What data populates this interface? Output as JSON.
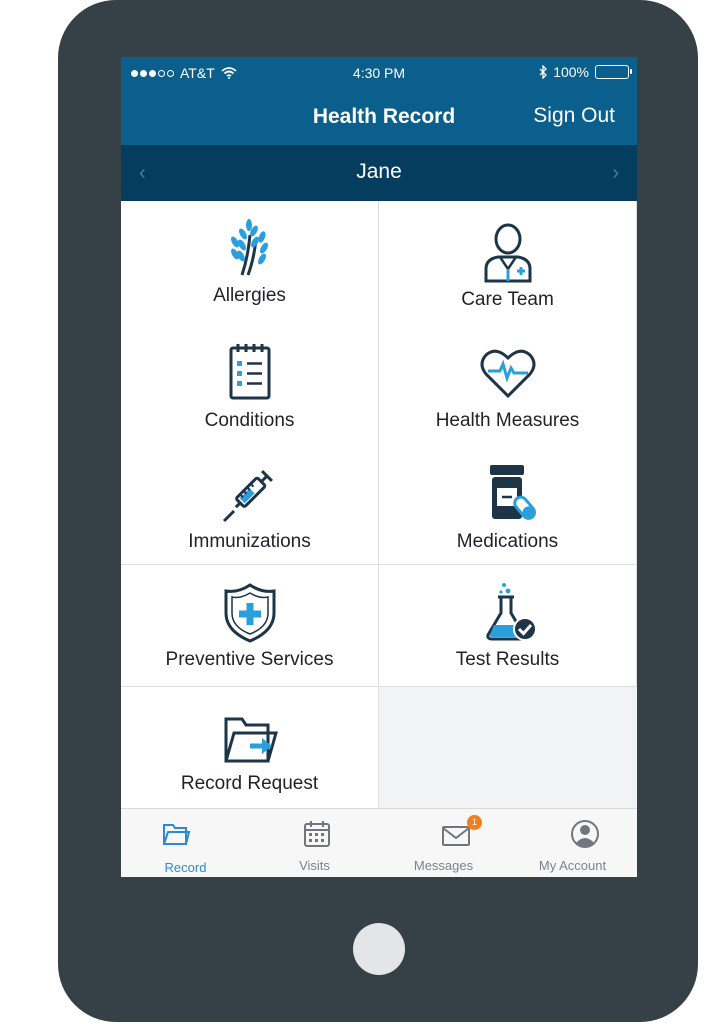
{
  "status_bar": {
    "carrier": "AT&T",
    "time": "4:30 PM",
    "battery": "100%"
  },
  "nav": {
    "title": "Health Record",
    "sign_out": "Sign Out"
  },
  "patient": {
    "name": "Jane",
    "prev": "‹",
    "next": "›"
  },
  "tiles": [
    {
      "label": "Allergies",
      "icon": "wheat-icon"
    },
    {
      "label": "Care Team",
      "icon": "doctor-icon"
    },
    {
      "label": "Conditions",
      "icon": "clipboard-list-icon"
    },
    {
      "label": "Health Measures",
      "icon": "heart-pulse-icon"
    },
    {
      "label": "Immunizations",
      "icon": "syringe-icon"
    },
    {
      "label": "Medications",
      "icon": "pill-bottle-icon"
    },
    {
      "label": "Preventive Services",
      "icon": "shield-plus-icon"
    },
    {
      "label": "Test Results",
      "icon": "flask-check-icon"
    },
    {
      "label": "Record Request",
      "icon": "folder-arrow-icon"
    }
  ],
  "tabs": [
    {
      "label": "Record",
      "icon": "folder-icon",
      "active": true
    },
    {
      "label": "Visits",
      "icon": "calendar-icon"
    },
    {
      "label": "Messages",
      "icon": "envelope-icon",
      "badge": "1"
    },
    {
      "label": "My Account",
      "icon": "user-circle-icon"
    }
  ],
  "colors": {
    "header": "#0a5f8c",
    "patient_bar": "#053d5e",
    "icon_dark": "#1e3447",
    "icon_accent": "#2b9fdc",
    "badge": "#f07f20",
    "device": "#354047"
  }
}
